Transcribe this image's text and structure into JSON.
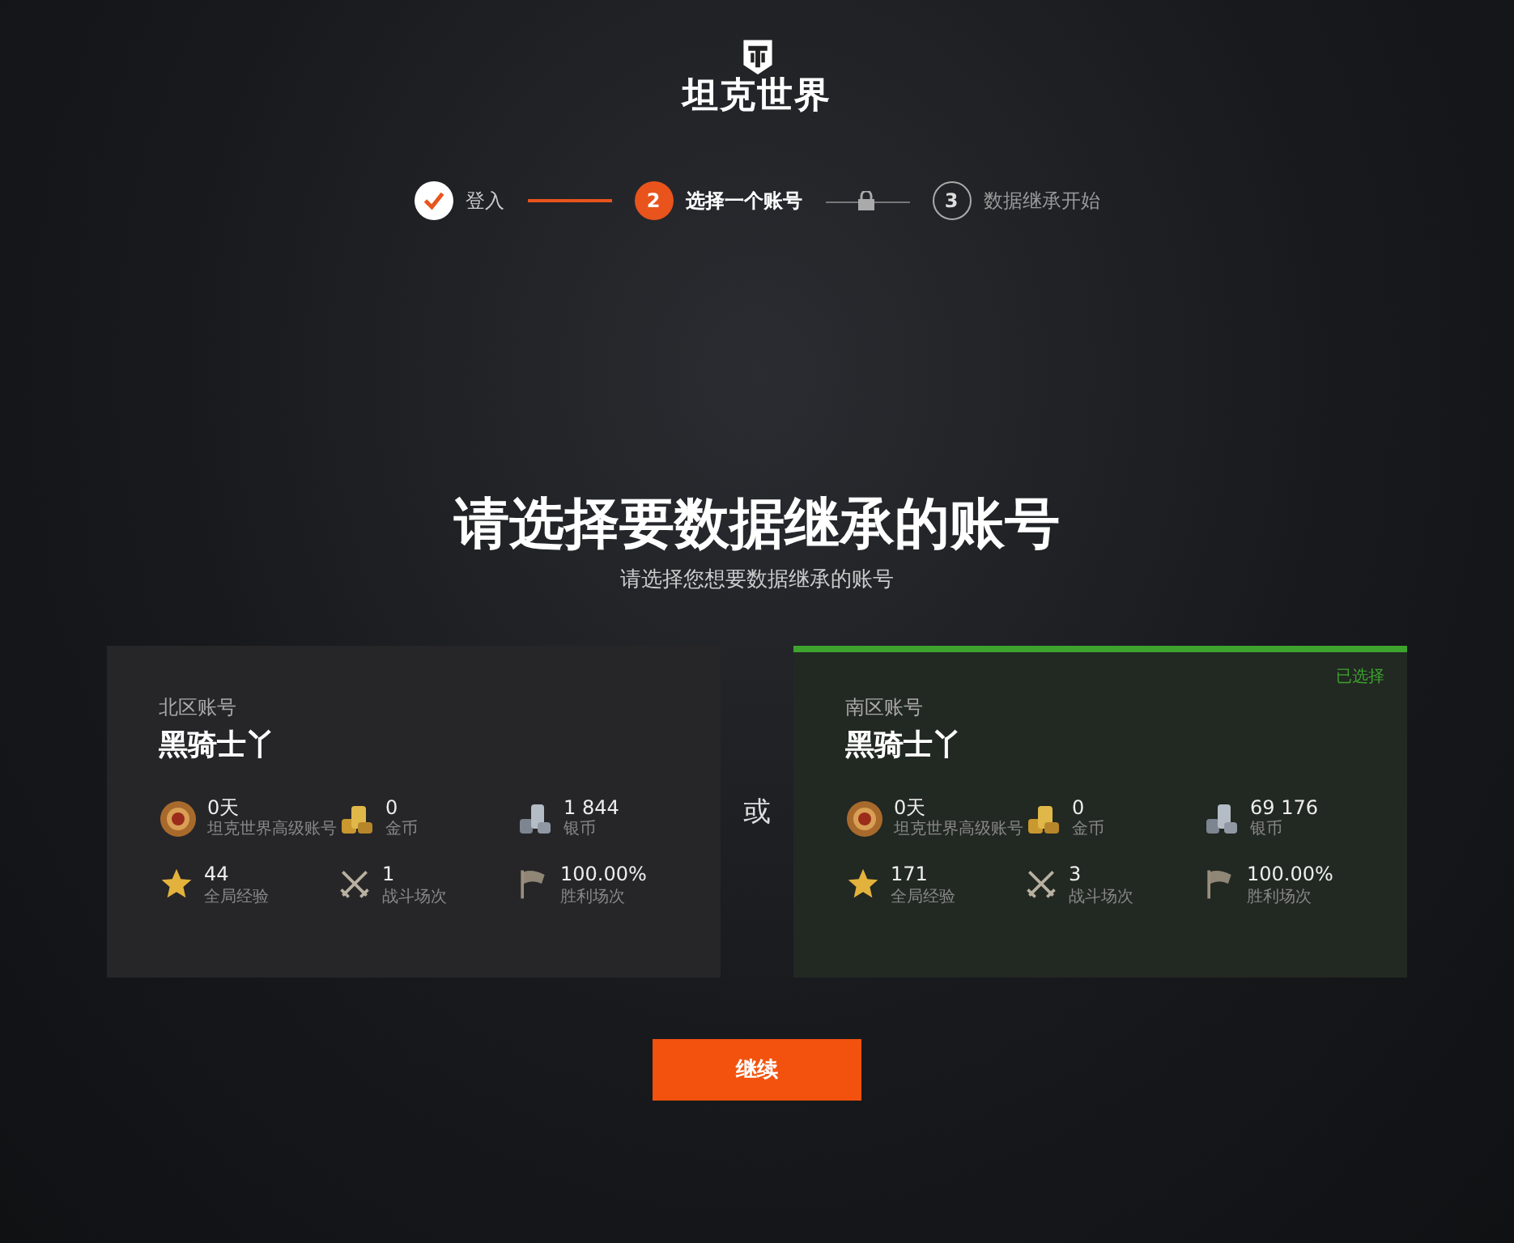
{
  "logo": {
    "text": "坦克世界"
  },
  "steps": [
    {
      "label": "登入",
      "done": true,
      "selected": false
    },
    {
      "number": "2",
      "label": "选择一个账号",
      "done": false,
      "selected": true
    },
    {
      "number": "3",
      "label": "数据继承开始",
      "done": false,
      "selected": false
    }
  ],
  "connectors": [
    {
      "kind": "complete"
    },
    {
      "kind": "locked"
    }
  ],
  "heading": "请选择要数据继承的账号",
  "subheading": "请选择您想要数据继承的账号",
  "separator": "或",
  "accounts": [
    {
      "region": "北区账号",
      "name": "黑骑士丫",
      "selected": false,
      "stats": [
        {
          "kind": "premium",
          "value": "0天",
          "label": "坦克世界高级账号"
        },
        {
          "kind": "gold",
          "value": "0",
          "label": "金币"
        },
        {
          "kind": "credits",
          "value": "1 844",
          "label": "银币"
        },
        {
          "kind": "xp",
          "value": "44",
          "label": "全局经验"
        },
        {
          "kind": "battles",
          "value": "1",
          "label": "战斗场次"
        },
        {
          "kind": "wins",
          "value": "100.00%",
          "label": "胜利场次"
        }
      ]
    },
    {
      "region": "南区账号",
      "name": "黑骑士丫",
      "selected": true,
      "badge": "已选择",
      "stats": [
        {
          "kind": "premium",
          "value": "0天",
          "label": "坦克世界高级账号"
        },
        {
          "kind": "gold",
          "value": "0",
          "label": "金币"
        },
        {
          "kind": "credits",
          "value": "69 176",
          "label": "银币"
        },
        {
          "kind": "xp",
          "value": "171",
          "label": "全局经验"
        },
        {
          "kind": "battles",
          "value": "3",
          "label": "战斗场次"
        },
        {
          "kind": "wins",
          "value": "100.00%",
          "label": "胜利场次"
        }
      ]
    }
  ],
  "continue_button": "继续"
}
